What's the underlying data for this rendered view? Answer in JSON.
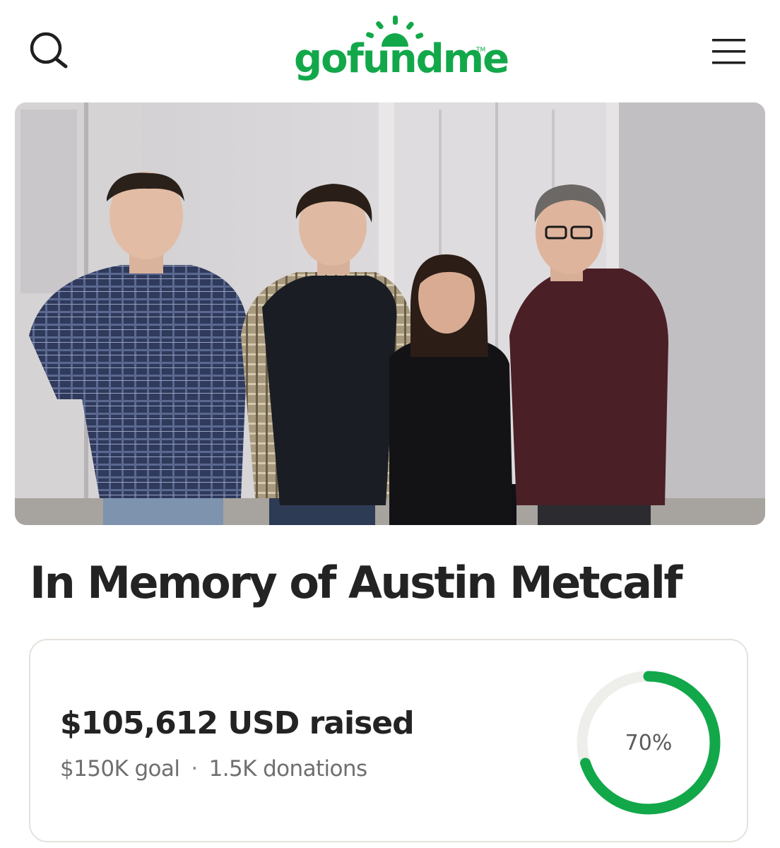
{
  "header": {
    "logo_text": "gofundme",
    "logo_tm": "TM",
    "search_icon": "search-icon",
    "menu_icon": "hamburger-menu-icon"
  },
  "campaign": {
    "title": "In Memory of Austin Metcalf",
    "photo_subject": "family-group-photo"
  },
  "donation_card": {
    "raised_text": "$105,612 USD raised",
    "goal_text": "$150K goal",
    "separator": "·",
    "donations_text": "1.5K donations",
    "progress_label": "70%",
    "progress_fraction": 0.7
  },
  "colors": {
    "brand_green": "#12a84a",
    "text_dark": "#232323",
    "text_muted": "#6f6f6f",
    "track_gray": "#eeeeea",
    "card_border": "#e5e2dd"
  }
}
